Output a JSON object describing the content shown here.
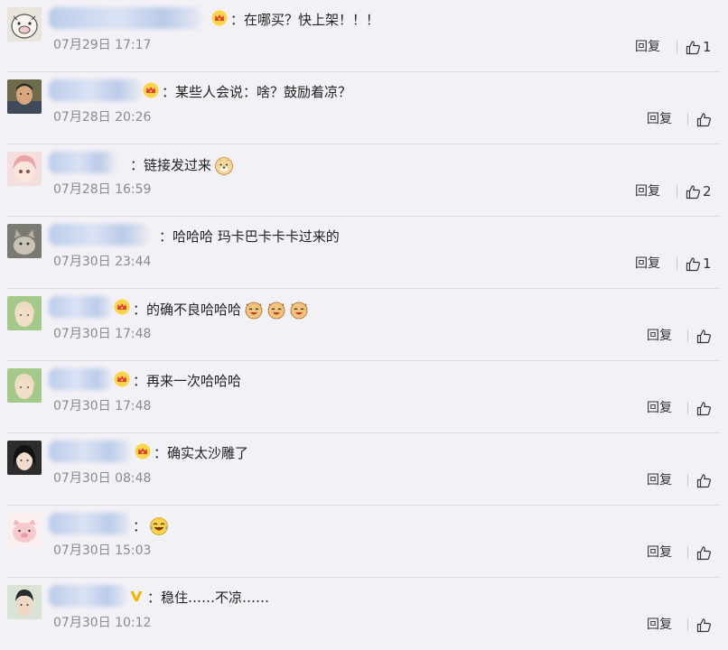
{
  "comments": [
    {
      "text": "：在哪买？快上架！！！",
      "date": "07月29日 17:17",
      "reply": "回复",
      "likes": "1",
      "badge": "crown",
      "avatar": "pig"
    },
    {
      "text": "：某些人会说：啥？鼓励着凉？",
      "date": "07月28日 20:26",
      "reply": "回复",
      "likes": "",
      "badge": "crown",
      "avatar": "man"
    },
    {
      "text": "：链接发过来",
      "date": "07月28日 16:59",
      "reply": "回复",
      "likes": "2",
      "badge": "",
      "avatar": "anime",
      "emoji": "doge"
    },
    {
      "text": "：哈哈哈 玛卡巴卡卡卡过来的",
      "date": "07月30日 23:44",
      "reply": "回复",
      "likes": "1",
      "badge": "",
      "avatar": "cat"
    },
    {
      "text": "：的确不良哈哈哈",
      "date": "07月30日 17:48",
      "reply": "回复",
      "likes": "",
      "badge": "crown",
      "avatar": "girl-green",
      "emoji": "cat-laugh",
      "emoji_count": 3
    },
    {
      "text": "：再来一次哈哈哈",
      "date": "07月30日 17:48",
      "reply": "回复",
      "likes": "",
      "badge": "crown",
      "avatar": "girl-green"
    },
    {
      "text": "：确实太沙雕了",
      "date": "07月30日 08:48",
      "reply": "回复",
      "likes": "",
      "badge": "crown",
      "avatar": "girl-dark"
    },
    {
      "text": "：",
      "date": "07月30日 15:03",
      "reply": "回复",
      "likes": "",
      "badge": "",
      "avatar": "pink-pig",
      "emoji": "laugh-cry"
    },
    {
      "text": "：稳住……不凉……",
      "date": "07月30日 10:12",
      "reply": "回复",
      "likes": "",
      "badge": "verified",
      "avatar": "boy"
    }
  ],
  "icons": {
    "like": "thumbs-up-icon",
    "crown": "crown-badge-icon",
    "verified": "verified-v-icon"
  },
  "colors": {
    "background": "#f2f1f6",
    "date_text": "#8a8a8f",
    "divider": "#dcdbe0",
    "crown": "#f5a623",
    "verified": "#f5b400"
  }
}
